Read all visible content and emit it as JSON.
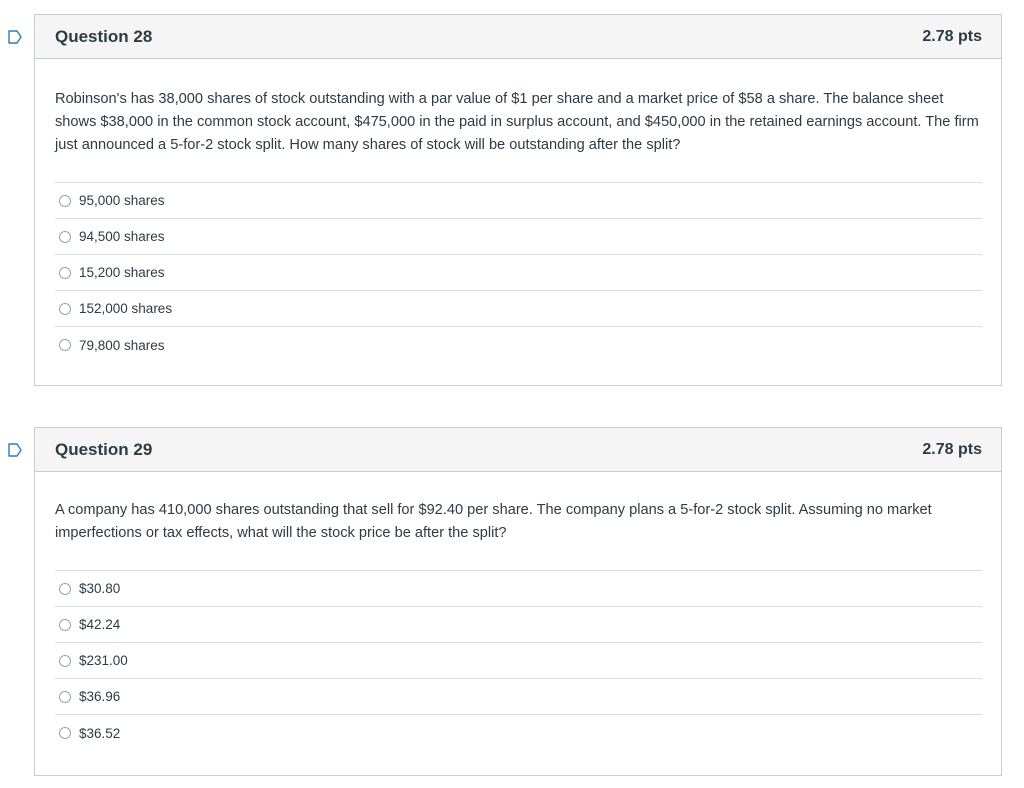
{
  "questions": [
    {
      "title": "Question 28",
      "points": "2.78 pts",
      "text": "Robinson's has 38,000 shares of stock outstanding with a par value of $1 per share and a market price of $58 a share. The balance sheet shows $38,000 in the common stock account, $475,000 in the paid in surplus account, and $450,000 in the retained earnings account. The firm just announced a 5-for-2 stock split. How many shares of stock will be outstanding after the split?",
      "answers": [
        "95,000 shares",
        "94,500 shares",
        "15,200 shares",
        "152,000 shares",
        "79,800 shares"
      ]
    },
    {
      "title": "Question 29",
      "points": "2.78 pts",
      "text": "A company has 410,000 shares outstanding that sell for $92.40 per share. The company plans a 5-for-2 stock split. Assuming no market imperfections or tax effects, what will the stock price be after the split?",
      "answers": [
        "$30.80",
        "$42.24",
        "$231.00",
        "$36.96",
        "$36.52"
      ]
    }
  ],
  "colors": {
    "flag": "#2b7abc",
    "header_bg": "#f5f5f5",
    "border": "#c7cdd1",
    "text": "#2d3b45"
  },
  "icons": {
    "flag": "flag-outline-icon",
    "radio": "radio-button-unselected"
  }
}
